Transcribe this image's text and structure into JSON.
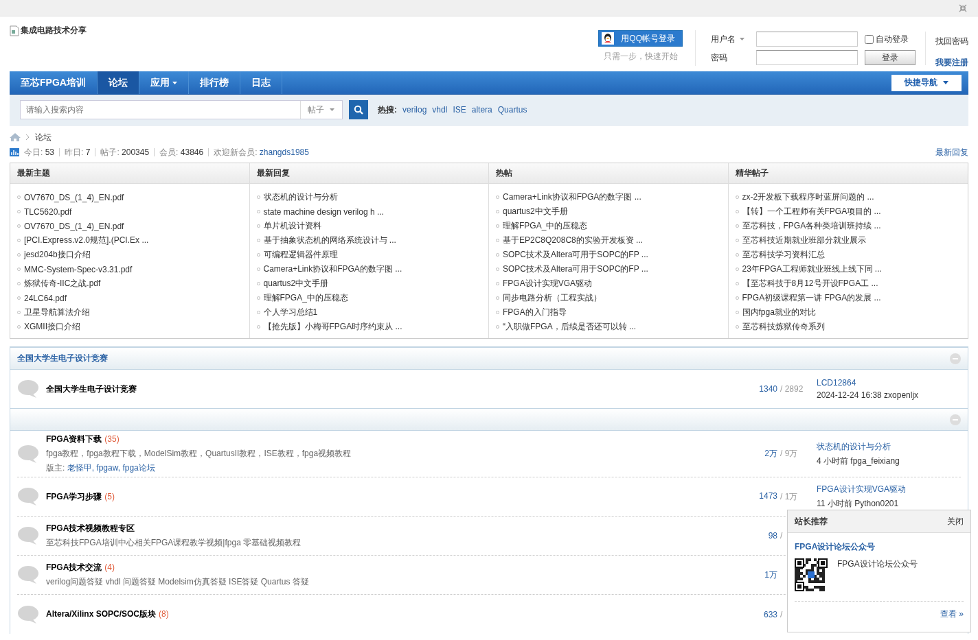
{
  "header": {
    "logo_alt": "集成电路技术分享",
    "qq_login": {
      "button": "用QQ帐号登录",
      "hint": "只需一步，快速开始"
    },
    "login": {
      "username_label": "用户名",
      "password_label": "密码",
      "auto_login": {
        "label": "自动登录",
        "checked": false
      },
      "submit": "登录",
      "links": [
        "找回密码",
        "我要注册"
      ]
    }
  },
  "nav": {
    "items": [
      {
        "label": "至芯FPGA培训",
        "selected": false,
        "dropdown": false
      },
      {
        "label": "论坛",
        "selected": true,
        "dropdown": false
      },
      {
        "label": "应用",
        "selected": false,
        "dropdown": true
      },
      {
        "label": "排行榜",
        "selected": false,
        "dropdown": false
      },
      {
        "label": "日志",
        "selected": false,
        "dropdown": false
      }
    ],
    "quick_nav": "快捷导航"
  },
  "search": {
    "placeholder": "请输入搜索内容",
    "type": "帖子",
    "hot_label": "热搜:",
    "hot": [
      "verilog",
      "vhdl",
      "ISE",
      "altera",
      "Quartus"
    ]
  },
  "breadcrumb": [
    "论坛"
  ],
  "stats": {
    "items": [
      {
        "label": "今日:",
        "value": "53"
      },
      {
        "label": "昨日:",
        "value": "7"
      },
      {
        "label": "帖子:",
        "value": "200345"
      },
      {
        "label": "会员:",
        "value": "43846"
      }
    ],
    "new_member_label": "欢迎新会员:",
    "new_member": "zhangds1985",
    "latest_reply": "最新回复"
  },
  "portal": [
    {
      "title": "最新主题",
      "items": [
        "OV7670_DS_(1_4)_EN.pdf",
        "TLC5620.pdf",
        "OV7670_DS_(1_4)_EN.pdf",
        "[PCI.Express.v2.0规范].(PCI.Ex ...",
        "jesd204b接口介绍",
        "MMC-System-Spec-v3.31.pdf",
        "炼狱传奇-IIC之战.pdf",
        "24LC64.pdf",
        "卫星导航算法介绍",
        "XGMII接口介绍"
      ]
    },
    {
      "title": "最新回复",
      "items": [
        "状态机的设计与分析",
        "state machine design verilog h ...",
        "单片机设计资料",
        "基于抽象状态机的网络系统设计与 ...",
        "可编程逻辑器件原理",
        "Camera+Link协议和FPGA的数字图 ...",
        "quartus2中文手册",
        "理解FPGA_中的压稳态",
        "个人学习总结1",
        "【抢先版】小梅哥FPGA时序约束从 ..."
      ]
    },
    {
      "title": "热帖",
      "items": [
        "Camera+Link协议和FPGA的数字图 ...",
        "quartus2中文手册",
        "理解FPGA_中的压稳态",
        "基于EP2C8Q208C8的实验开发板资 ...",
        "SOPC技术及Altera可用于SOPC的FP ...",
        "SOPC技术及Altera可用于SOPC的FP ...",
        "FPGA设计实现VGA驱动",
        "同步电路分析（工程实战）",
        "FPGA的入门指导",
        "“入职做FPGA，后续是否还可以转 ..."
      ]
    },
    {
      "title": "精华帖子",
      "items": [
        "zx-2开发板下载程序时蓝屏问题的 ...",
        "【转】一个工程师有关FPGA项目的 ...",
        "至芯科技，FPGA各种类培训班持续 ...",
        "至芯科技近期就业班部分就业展示",
        "至芯科技学习资料汇总",
        "23年FPGA工程师就业班线上线下同 ...",
        "【至芯科技于8月12号开设FPGA工 ...",
        "FPGA初级课程第一讲 FPGA的发展 ...",
        "国内fpga就业的对比",
        "至芯科技炼狱传奇系列"
      ]
    }
  ],
  "categories": [
    {
      "title": "全国大学生电子设计竞赛",
      "forums": [
        {
          "name": "全国大学生电子设计竞赛",
          "threads": "1340",
          "posts": "/ 2892",
          "last_title": "LCD12864",
          "last_meta": "2024-12-24 16:38 zxopenljx"
        }
      ]
    },
    {
      "forums": [
        {
          "name": "FPGA资料下载",
          "count": "(35)",
          "description": "fpga教程，fpga教程下载，ModelSim教程，QuartusII教程，ISE教程，fpga视频教程",
          "moderators_label": "版主:",
          "moderators": "老怪甲, fpgaw, fpga论坛",
          "threads": "2万",
          "posts": "/ 9万",
          "last_title": "状态机的设计与分析",
          "last_meta": "4 小时前 fpga_feixiang"
        },
        {
          "name": "FPGA学习步骤",
          "count": "(5)",
          "threads": "1473",
          "posts": "/ 1万",
          "last_title": "FPGA设计实现VGA驱动",
          "last_meta": "11 小时前 Python0201"
        },
        {
          "name": "FPGA技术视频教程专区",
          "description": "至芯科技FPGA培训中心相关FPGA课程教学视频|fpga 零基础视频教程",
          "threads": "98",
          "posts": "/"
        },
        {
          "name": "FPGA技术交流",
          "count": "(4)",
          "description": "verilog问题答疑 vhdl 问题答疑 Modelsim仿真答疑 ISE答疑 Quartus 答疑",
          "threads": "1万"
        },
        {
          "name": "Altera/Xilinx SOPC/SOC版块",
          "count": "(8)",
          "threads": "633",
          "posts": "/"
        }
      ]
    }
  ],
  "popup": {
    "title": "站长推荐",
    "close": "关闭",
    "heading": "FPGA设计论坛公众号",
    "caption": "FPGA设计论坛公众号",
    "more": "查看 »"
  }
}
